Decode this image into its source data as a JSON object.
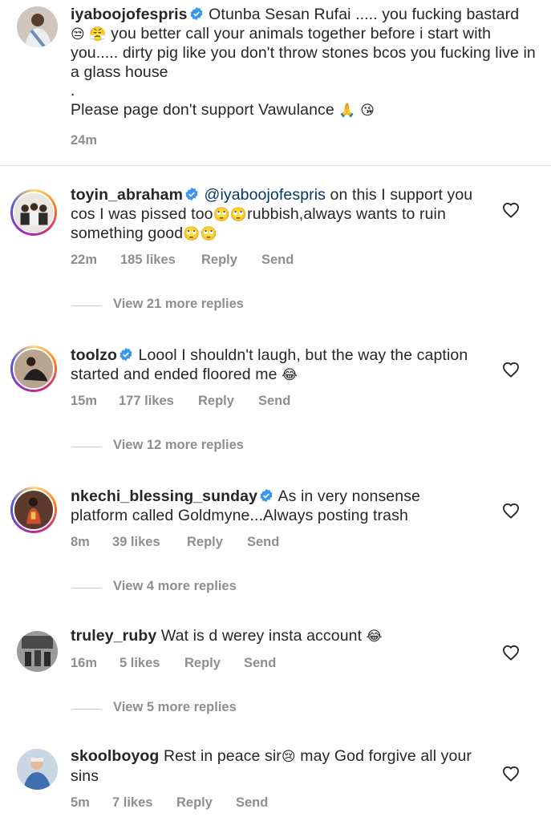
{
  "caption": {
    "username": "iyaboojofespris",
    "text": "Otunba Sesan Rufai ..... you fucking bastard",
    "text2": "you better call your animals together before i start with you..... dirty pig like you don't throw stones bcos you fucking live in a glass house",
    "dot": ".",
    "text3": "Please page don't support Vawulance",
    "emoji1": "😒",
    "emoji2": "😤",
    "emoji3": "🙏",
    "emoji4": "😘",
    "time": "24m"
  },
  "comments": [
    {
      "username": "toyin_abraham",
      "mention": "@iyaboojofespris",
      "text_a": "on this I support you cos I was pissed too",
      "emoji_a": "🙄🙄",
      "text_b": "rubbish,always wants to ruin something good",
      "emoji_b": "🙄🙄",
      "time": "22m",
      "likes": "185 likes",
      "reply": "Reply",
      "send": "Send",
      "more_replies": "View 21 more replies"
    },
    {
      "username": "toolzo",
      "text_a": "Loool I shouldn't laugh, but the way the caption started and ended floored me",
      "emoji_a": "😂",
      "time": "15m",
      "likes": "177 likes",
      "reply": "Reply",
      "send": "Send",
      "more_replies": "View 12 more replies"
    },
    {
      "username": "nkechi_blessing_sunday",
      "text_a": "As in very nonsense platform called Goldmyne...Always posting trash",
      "time": "8m",
      "likes": "39 likes",
      "reply": "Reply",
      "send": "Send",
      "more_replies": "View 4 more replies"
    },
    {
      "username": "truley_ruby",
      "text_a": "Wat is d werey insta account",
      "emoji_a": "😂",
      "time": "16m",
      "likes": "5 likes",
      "reply": "Reply",
      "send": "Send",
      "more_replies": "View 5 more replies"
    },
    {
      "username": "skoolboyog",
      "text_a": "Rest in peace sir",
      "emoji_a": "😢",
      "text_b": "may God forgive all your sins",
      "time": "5m",
      "likes": "7 likes",
      "reply": "Reply",
      "send": "Send"
    }
  ],
  "icons": {
    "verified": "verified-badge-icon",
    "like": "heart-outline-icon"
  },
  "colors": {
    "text": "#262626",
    "muted": "#8e8e8e",
    "verified": "#3897f0",
    "mention": "#00376b"
  }
}
